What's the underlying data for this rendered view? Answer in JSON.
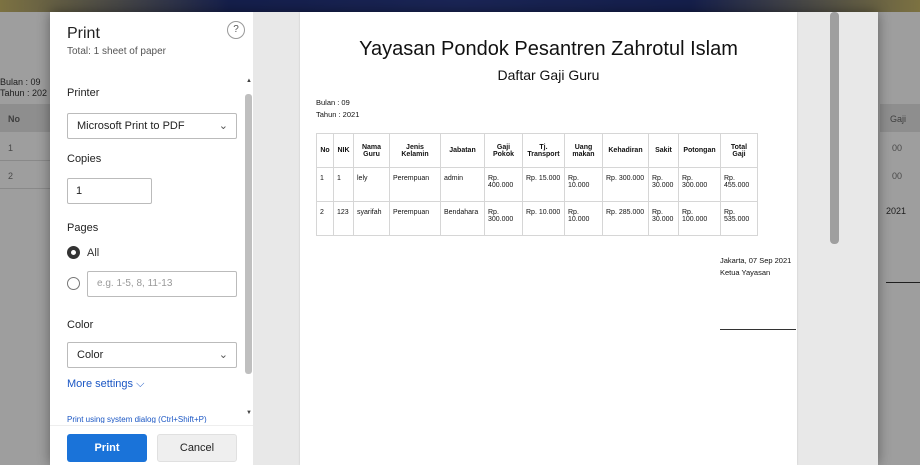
{
  "background": {
    "meta_bulan": "Bulan : 09",
    "meta_tahun": "Tahun : 202",
    "col_no": "No",
    "rows": [
      "1",
      "2"
    ],
    "right_col": "Gaji",
    "right_cells": [
      "00",
      "00"
    ],
    "right_year": "2021"
  },
  "panel": {
    "title": "Print",
    "subtitle": "Total: 1 sheet of paper",
    "help": "?",
    "printer_label": "Printer",
    "printer_value": "Microsoft Print to PDF",
    "copies_label": "Copies",
    "copies_value": "1",
    "pages_label": "Pages",
    "pages_all": "All",
    "pages_placeholder": "e.g. 1-5, 8, 11-13",
    "color_label": "Color",
    "color_value": "Color",
    "more_settings": "More settings ⌵",
    "system_dialog": "Print using system dialog (Ctrl+Shift+P)"
  },
  "actions": {
    "print": "Print",
    "cancel": "Cancel"
  },
  "document": {
    "title": "Yayasan Pondok Pesantren Zahrotul Islam",
    "subtitle": "Daftar Gaji Guru",
    "bulan": "Bulan : 09",
    "tahun": "Tahun : 2021",
    "table": {
      "headers": [
        "No",
        "NIK",
        "Nama Guru",
        "Jenis Kelamin",
        "Jabatan",
        "Gaji Pokok",
        "Tj. Transport",
        "Uang makan",
        "Kehadiran",
        "Sakit",
        "Potongan",
        "Total Gaji"
      ],
      "rows": [
        [
          "1",
          "1",
          "lely",
          "Perempuan",
          "admin",
          "Rp. 400.000",
          "Rp. 15.000",
          "Rp. 10.000",
          "Rp. 300.000",
          "Rp. 30.000",
          "Rp. 300.000",
          "Rp. 455.000"
        ],
        [
          "2",
          "123",
          "syarifah",
          "Perempuan",
          "Bendahara",
          "Rp. 300.000",
          "Rp. 10.000",
          "Rp. 10.000",
          "Rp. 285.000",
          "Rp. 30.000",
          "Rp. 100.000",
          "Rp. 535.000"
        ]
      ]
    },
    "sign_date": "Jakarta, 07 Sep 2021",
    "sign_role": "Ketua Yayasan"
  },
  "icons": {
    "chevron_down": "chevron-down-icon",
    "help": "help-icon"
  }
}
